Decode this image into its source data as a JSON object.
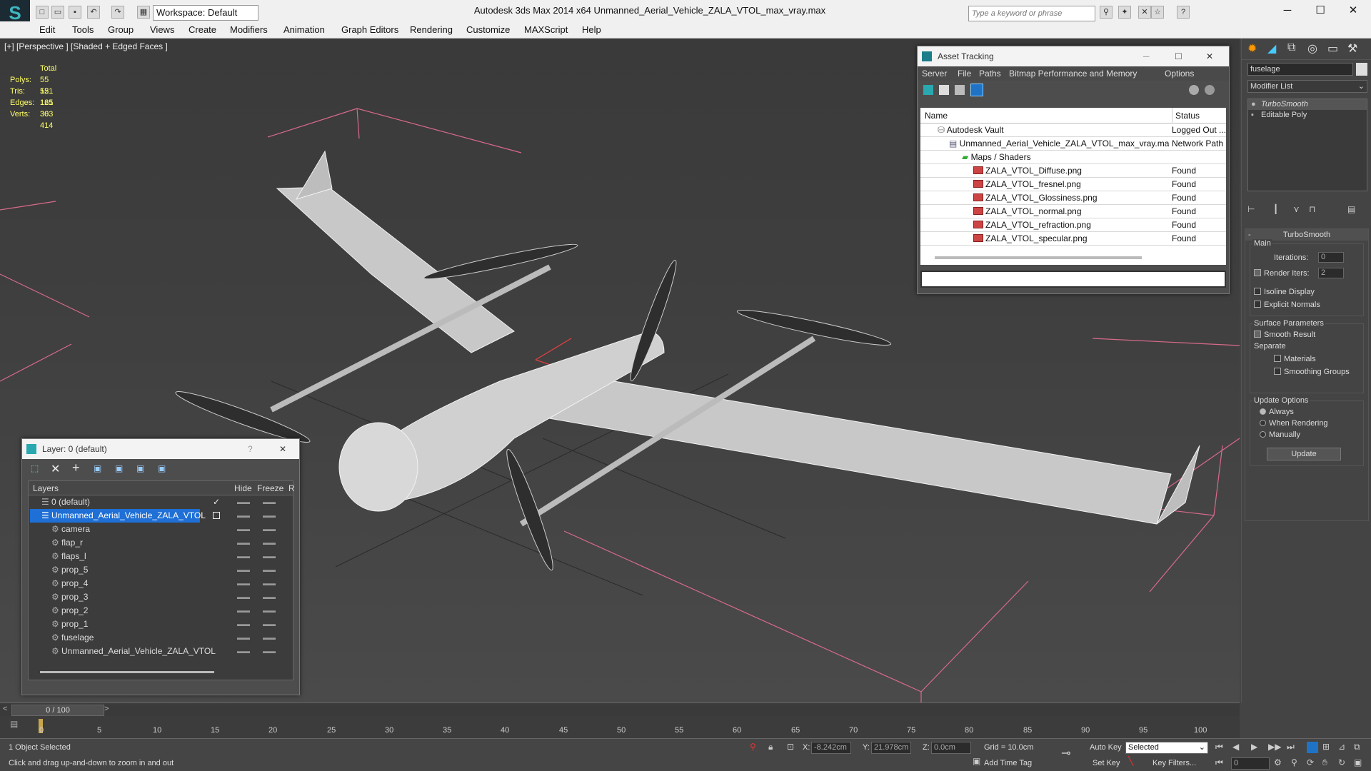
{
  "titlebar": {
    "workspace": "Workspace: Default",
    "app_title": "Autodesk 3ds Max  2014 x64      Unmanned_Aerial_Vehicle_ZALA_VTOL_max_vray.max",
    "search_placeholder": "Type a keyword or phrase"
  },
  "menu": [
    "Edit",
    "Tools",
    "Group",
    "Views",
    "Create",
    "Modifiers",
    "Animation",
    "Graph Editors",
    "Rendering",
    "Customize",
    "MAXScript",
    "Help"
  ],
  "viewport": {
    "label": "[+] [Perspective ] [Shaded + Edged Faces ]",
    "stats": {
      "header": "Total",
      "rows": [
        {
          "label": "Polys:",
          "value": "55 121"
        },
        {
          "label": "Tris:",
          "value": "55 121"
        },
        {
          "label": "Edges:",
          "value": "165 363"
        },
        {
          "label": "Verts:",
          "value": "30 414"
        }
      ]
    }
  },
  "asset_tracking": {
    "title": "Asset Tracking",
    "menu": [
      "Server",
      "File",
      "Paths",
      "Bitmap Performance and Memory",
      "Options"
    ],
    "columns": {
      "name": "Name",
      "status": "Status"
    },
    "rows": [
      {
        "name": "Autodesk Vault",
        "status": "Logged Out ...",
        "indent": 1,
        "icon": "vault"
      },
      {
        "name": "Unmanned_Aerial_Vehicle_ZALA_VTOL_max_vray.max",
        "status": "Network Path",
        "indent": 2,
        "icon": "file"
      },
      {
        "name": "Maps / Shaders",
        "status": "",
        "indent": 3,
        "icon": "folder"
      },
      {
        "name": "ZALA_VTOL_Diffuse.png",
        "status": "Found",
        "indent": 4,
        "icon": "png"
      },
      {
        "name": "ZALA_VTOL_fresnel.png",
        "status": "Found",
        "indent": 4,
        "icon": "png"
      },
      {
        "name": "ZALA_VTOL_Glossiness.png",
        "status": "Found",
        "indent": 4,
        "icon": "png"
      },
      {
        "name": "ZALA_VTOL_normal.png",
        "status": "Found",
        "indent": 4,
        "icon": "png"
      },
      {
        "name": "ZALA_VTOL_refraction.png",
        "status": "Found",
        "indent": 4,
        "icon": "png"
      },
      {
        "name": "ZALA_VTOL_specular.png",
        "status": "Found",
        "indent": 4,
        "icon": "png"
      }
    ]
  },
  "layer_dialog": {
    "title": "Layer: 0 (default)",
    "columns": {
      "layers": "Layers",
      "hide": "Hide",
      "freeze": "Freeze",
      "extra": "R"
    },
    "rows": [
      {
        "name": "0 (default)",
        "level": 0,
        "selected": false,
        "active": true
      },
      {
        "name": "Unmanned_Aerial_Vehicle_ZALA_VTOL",
        "level": 0,
        "selected": true,
        "active": false
      },
      {
        "name": "camera",
        "level": 1,
        "selected": false,
        "active": false
      },
      {
        "name": "flap_r",
        "level": 1,
        "selected": false,
        "active": false
      },
      {
        "name": "flaps_l",
        "level": 1,
        "selected": false,
        "active": false
      },
      {
        "name": "prop_5",
        "level": 1,
        "selected": false,
        "active": false
      },
      {
        "name": "prop_4",
        "level": 1,
        "selected": false,
        "active": false
      },
      {
        "name": "prop_3",
        "level": 1,
        "selected": false,
        "active": false
      },
      {
        "name": "prop_2",
        "level": 1,
        "selected": false,
        "active": false
      },
      {
        "name": "prop_1",
        "level": 1,
        "selected": false,
        "active": false
      },
      {
        "name": "fuselage",
        "level": 1,
        "selected": false,
        "active": false
      },
      {
        "name": "Unmanned_Aerial_Vehicle_ZALA_VTOL",
        "level": 1,
        "selected": false,
        "active": false
      }
    ]
  },
  "command_panel": {
    "object_name": "fuselage",
    "modifier_list": "Modifier List",
    "stack": [
      "TurboSmooth",
      "Editable Poly"
    ],
    "rollout_title": "TurboSmooth",
    "main_label": "Main",
    "iterations_label": "Iterations:",
    "iterations_value": "0",
    "render_iters_label": "Render Iters:",
    "render_iters_value": "2",
    "isoline": "Isoline Display",
    "explicit_normals": "Explicit Normals",
    "surface_params": "Surface Parameters",
    "smooth_result": "Smooth Result",
    "separate": "Separate",
    "materials": "Materials",
    "smoothing_groups": "Smoothing Groups",
    "update_options": "Update Options",
    "always": "Always",
    "when_rendering": "When Rendering",
    "manually": "Manually",
    "update_button": "Update"
  },
  "timeline": {
    "frame": "0 / 100",
    "ticks": [
      "0",
      "5",
      "10",
      "15",
      "20",
      "25",
      "30",
      "35",
      "40",
      "45",
      "50",
      "55",
      "60",
      "65",
      "70",
      "75",
      "80",
      "85",
      "90",
      "95",
      "100"
    ]
  },
  "status": {
    "selection": "1 Object Selected",
    "prompt": "Click and drag up-and-down to zoom in and out",
    "x_label": "X:",
    "x_value": "-8.242cm",
    "y_label": "Y:",
    "y_value": "21.978cm",
    "z_label": "Z:",
    "z_value": "0.0cm",
    "grid": "Grid = 10.0cm",
    "add_time_tag": "Add Time Tag",
    "auto_key": "Auto Key",
    "selected": "Selected",
    "set_key": "Set Key",
    "key_filters": "Key Filters...",
    "frame_field": "0"
  }
}
